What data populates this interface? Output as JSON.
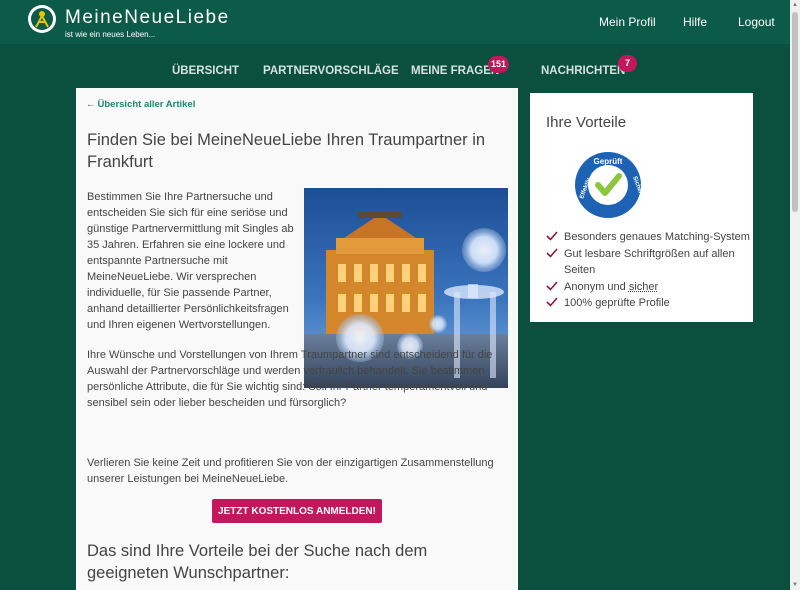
{
  "header": {
    "brand": "MeineNeueLiebe",
    "tagline": "ist wie ein neues Leben...",
    "links": {
      "profile": "Mein Profil",
      "help": "Hilfe",
      "logout": "Logout"
    }
  },
  "nav": {
    "overview": "Übersicht",
    "suggestions": "Partnervorschläge",
    "questions": "Meine Fragen",
    "questions_badge": "151",
    "messages": "Nachrichten",
    "messages_badge": "7"
  },
  "article": {
    "back": "Übersicht aller Artikel",
    "title": "Finden Sie bei MeineNeueLiebe Ihren Traumpartner in Frankfurt",
    "p1": "Bestimmen Sie Ihre Partnersuche und entscheiden Sie sich für eine seriöse und günstige Partnervermittlung mit Singles ab 35 Jahren. Erfahren sie eine lockere und entspannte Partnersuche mit MeineNeueLiebe. Wir versprechen individuelle, für Sie passende Partner, anhand detaillierter Persönlichkeitsfragen und Ihren eigenen Wertvorstellungen.",
    "p2": "Ihre Wünsche und Vorstellungen von Ihrem Traumpartner sind entscheidend für die Auswahl der Partnervorschläge und werden vertraulich behandelt. Sie bestimmen persönliche Attribute, die für Sie wichtig sind: Soll Ihr Partner temperamentvoll und sensibel sein oder lieber bescheiden und fürsorglich?",
    "p3": "Verlieren Sie keine Zeit und profitieren Sie von der einzigartigen Zusammenstellung unserer Leistungen bei MeineNeueLiebe.",
    "cta": "Jetzt kostenlos anmelden!",
    "subtitle": "Das sind Ihre Vorteile bei der Suche nach dem geeigneten Wunschpartner:"
  },
  "sidebar": {
    "title": "Ihre Vorteile",
    "seal_top": "Geprüft",
    "seal_left": "Effektiv",
    "seal_right": "Sicher",
    "items": [
      "Besonders genaues Matching-System",
      "Gut lesbare Schriftgrößen auf allen Seiten",
      "Anonym und",
      "100% geprüfte Profile"
    ],
    "item3_link": "sicher"
  },
  "colors": {
    "header_bg": "#0c5a48",
    "page_bg": "#0b4f3f",
    "accent_pink": "#c2185b",
    "link_green": "#1a8a6e",
    "check": "#8b1a3a"
  }
}
